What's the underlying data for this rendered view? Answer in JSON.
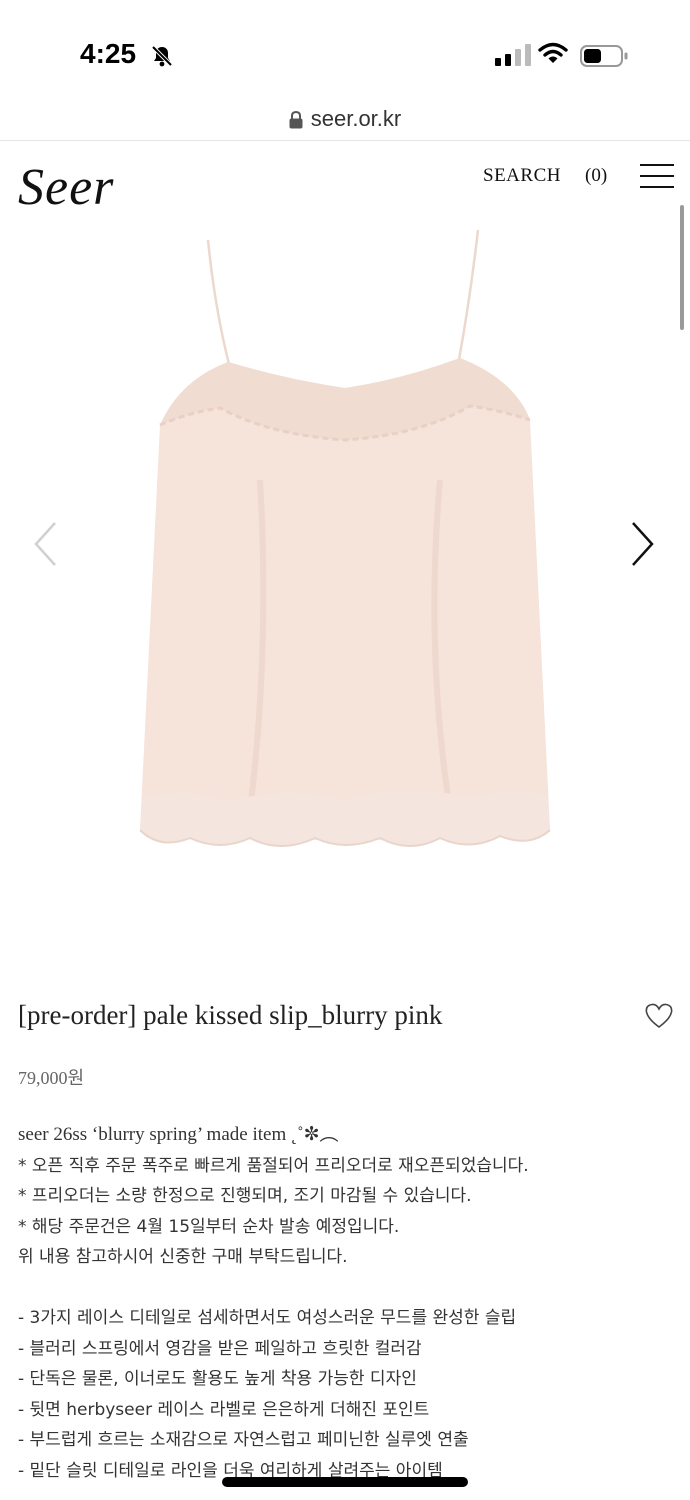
{
  "status_bar": {
    "time": "4:25",
    "bell_icon": "bell-slash-icon",
    "signal_icon": "cellular-signal-icon",
    "wifi_icon": "wifi-icon",
    "battery_icon": "battery-icon"
  },
  "browser": {
    "url": "seer.or.kr",
    "lock_icon": "lock-icon"
  },
  "header": {
    "logo": "Seer",
    "search_label": "SEARCH",
    "cart_count": "(0)",
    "menu_icon": "hamburger-menu-icon"
  },
  "product": {
    "image_icon": "slip-dress-image",
    "prev_icon": "chevron-left-icon",
    "next_icon": "chevron-right-icon",
    "title": "[pre-order] pale kissed slip_blurry pink",
    "wishlist_icon": "heart-icon",
    "price": "79,000원",
    "description": [
      "seer 26ss ‘blurry spring’ made item ˛˚✼︵",
      "* 오픈 직후 주문 폭주로 빠르게 품절되어 프리오더로 재오픈되었습니다.",
      "* 프리오더는 소량 한정으로 진행되며, 조기 마감될 수 있습니다.",
      "* 해당 주문건은 4월 15일부터 순차 발송 예정입니다.",
      "위 내용 참고하시어 신중한 구매 부탁드립니다.",
      "",
      "- 3가지 레이스 디테일로 섬세하면서도 여성스러운 무드를 완성한 슬립",
      "- 블러리 스프링에서 영감을 받은 페일하고 흐릿한 컬러감",
      "- 단독은 물론, 이너로도 활용도 높게 착용 가능한 디자인",
      "- 뒷면 herbyseer 레이스 라벨로 은은하게 더해진 포인트",
      "- 부드럽게 흐르는 소재감으로 자연스럽고 페미닌한 실루엣 연출",
      "- 밑단 슬릿 디테일로 라인을 더욱 여리하게 살려주는 아이템"
    ]
  },
  "colors": {
    "fabric": "#f6e3da",
    "lace": "#f2ddd2",
    "text": "#222222",
    "price": "#666666"
  }
}
